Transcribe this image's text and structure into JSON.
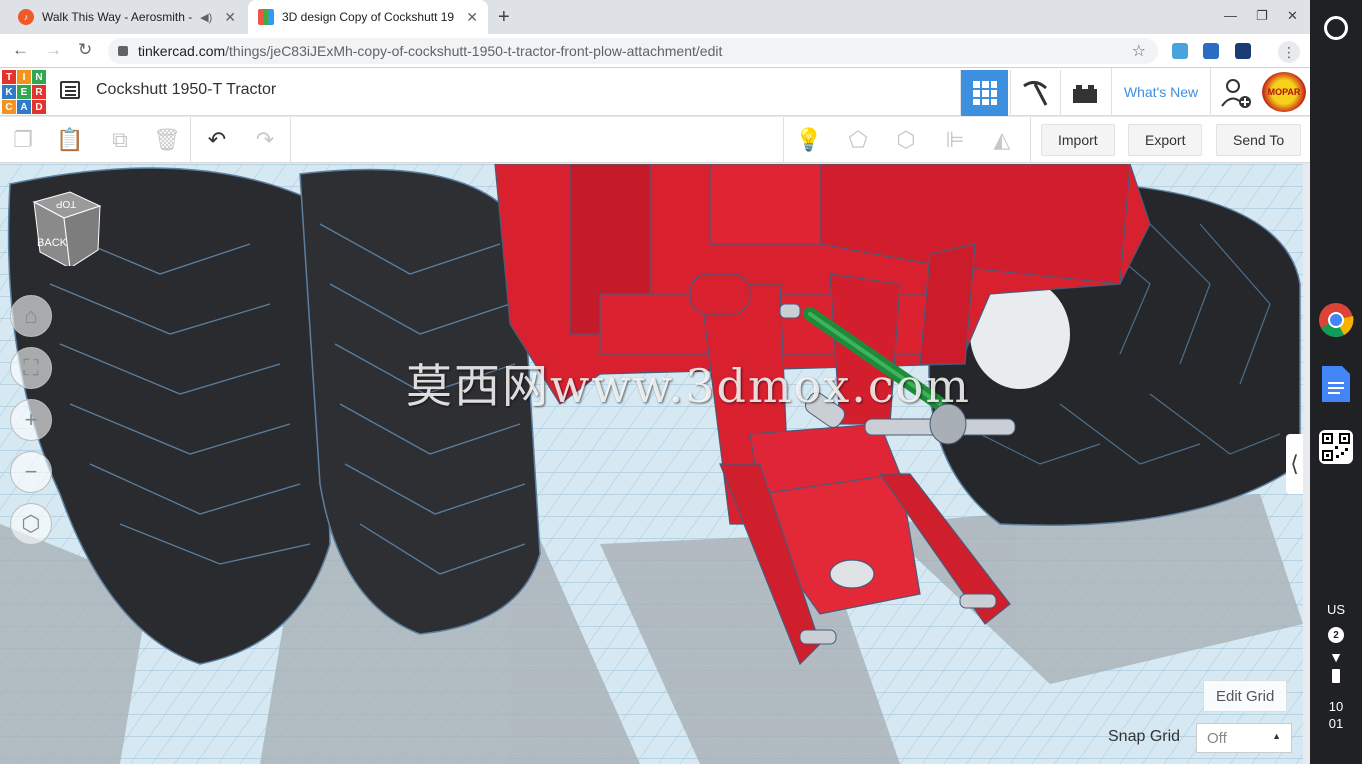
{
  "browser": {
    "tabs": [
      {
        "title": "Walk This Way - Aerosmith -",
        "active": false,
        "audio": true
      },
      {
        "title": "3D design Copy of Cockshutt 19",
        "active": true,
        "audio": false
      }
    ],
    "url_host": "tinkercad.com",
    "url_path": "/things/jeC83iJExMh-copy-of-cockshutt-1950-t-tractor-front-plow-attachment/edit"
  },
  "header": {
    "logo_letters": [
      "TIN",
      "KER",
      "CAD"
    ],
    "design_title": "Cockshutt 1950-T Tractor",
    "whats_new": "What's New",
    "avatar_text": "MOPAR"
  },
  "toolbar": {
    "import": "Import",
    "export": "Export",
    "send_to": "Send To"
  },
  "viewport": {
    "viewcube_top": "TOP",
    "viewcube_back": "BACK",
    "watermark": "莫西网www.3dmox.com",
    "edit_grid": "Edit Grid",
    "snap_grid_label": "Snap Grid",
    "snap_grid_value": "Off"
  },
  "status": {
    "locale": "US",
    "notifications": "2",
    "time_hour": "10",
    "time_minute": "01"
  },
  "colors": {
    "accent": "#3d8fe0",
    "tractor_red": "#d8202f",
    "tire": "#2a2b2e",
    "hose": "#1f8a3a"
  }
}
